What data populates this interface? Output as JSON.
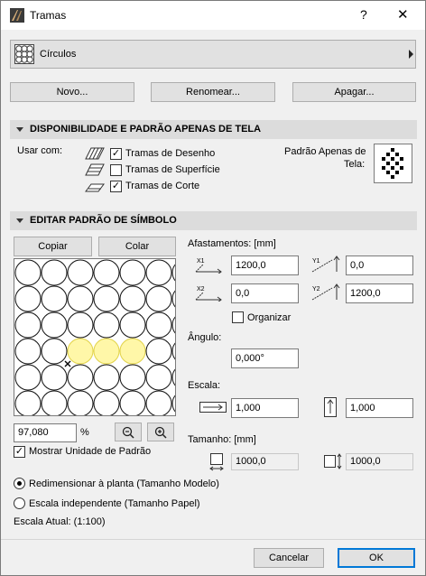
{
  "window": {
    "title": "Tramas",
    "help_label": "?",
    "close_label": "✕"
  },
  "pattern_selector": {
    "current": "Círculos"
  },
  "toolbar": {
    "new_label": "Novo...",
    "rename_label": "Renomear...",
    "delete_label": "Apagar..."
  },
  "availability": {
    "header": "DISPONIBILIDADE E PADRÃO APENAS DE TELA",
    "use_with_label": "Usar com:",
    "options": [
      {
        "label": "Tramas de Desenho",
        "checked": true
      },
      {
        "label": "Tramas de Superfície",
        "checked": false
      },
      {
        "label": "Tramas de Corte",
        "checked": true
      }
    ],
    "screen_pattern_label_1": "Padrão Apenas de",
    "screen_pattern_label_2": "Tela:"
  },
  "edit": {
    "header": "EDITAR PADRÃO DE SÍMBOLO",
    "copy_label": "Copiar",
    "paste_label": "Colar",
    "zoom_value": "97,080",
    "zoom_unit": "%",
    "show_unit_label": "Mostrar Unidade de Padrão",
    "show_unit_checked": true,
    "offsets_label": "Afastamentos: [mm]",
    "x1": "1200,0",
    "y1": "0,0",
    "x2": "0,0",
    "y2": "1200,0",
    "organize_label": "Organizar",
    "organize_checked": false,
    "angle_label": "Ângulo:",
    "angle_value": "0,000°",
    "scale_label": "Escala:",
    "scale_x": "1,000",
    "scale_y": "1,000",
    "size_label": "Tamanho: [mm]",
    "size_w": "1000,0",
    "size_h": "1000,0"
  },
  "scaling": {
    "option1": "Redimensionar à planta (Tamanho Modelo)",
    "option2": "Escala independente (Tamanho Papel)",
    "selected": 1,
    "current_scale": "Escala Atual: (1:100)"
  },
  "footer": {
    "cancel_label": "Cancelar",
    "ok_label": "OK"
  },
  "colors": {
    "ok_border": "#0078d7",
    "highlight": "#fff7a8",
    "header_bg": "#dcdcdc"
  }
}
